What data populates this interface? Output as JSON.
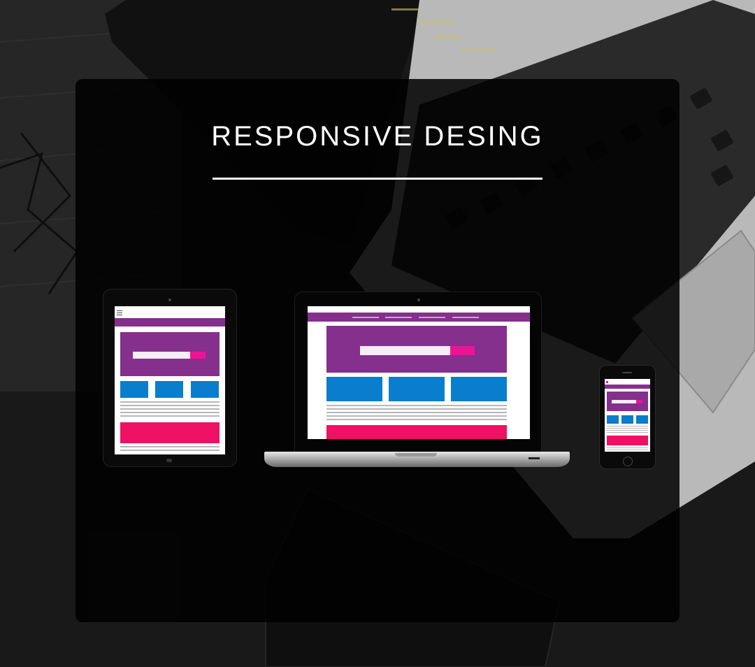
{
  "title": "RESPONSIVE DESING",
  "devices": [
    "tablet",
    "laptop",
    "phone"
  ],
  "colors": {
    "nav": "#84308c",
    "hero": "#84308c",
    "search_button": "#ec1397",
    "cards": "#0a7dcc",
    "footer_banner": "#ef1163",
    "panel": "#000000",
    "title_text": "#ffffff"
  },
  "icons": [
    "hamburger-menu-icon"
  ]
}
